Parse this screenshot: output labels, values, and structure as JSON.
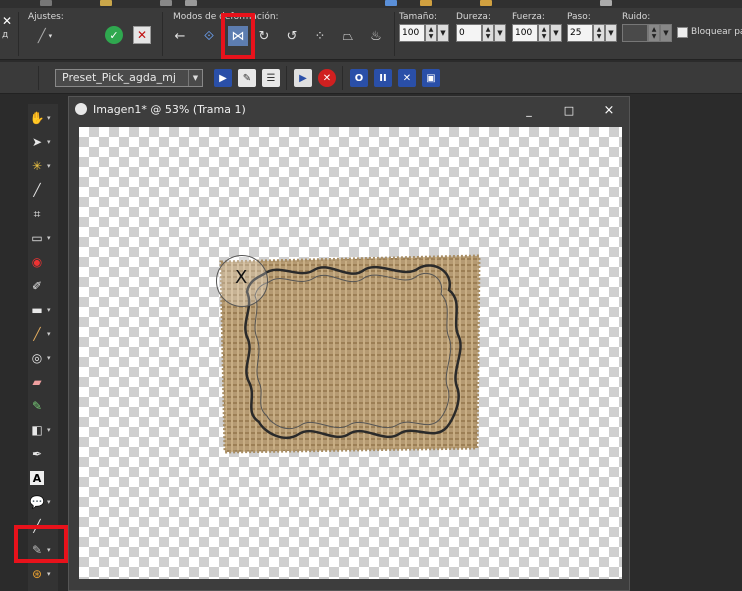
{
  "options": {
    "ajustes_label": "Ajustes:",
    "modos_label": "Modos de deformación:",
    "tamano": {
      "label": "Tamaño:",
      "value": "100"
    },
    "dureza": {
      "label": "Dureza:",
      "value": "0"
    },
    "fuerza": {
      "label": "Fuerza:",
      "value": "100"
    },
    "paso": {
      "label": "Paso:",
      "value": "25"
    },
    "ruido": {
      "label": "Ruido:",
      "value": ""
    },
    "lock_label": "Bloquear par",
    "left_fragment": "д"
  },
  "preset": {
    "selected": "Preset_Pick_agda_mj"
  },
  "image_window": {
    "title": "Imagen1* @  53% (Trama 1)",
    "minimize": "_",
    "maximize": "□",
    "close": "×"
  },
  "cursor_mark": "X",
  "colors": {
    "highlight": "#e8121b",
    "burlap": "#b59a72",
    "frame_line": "#2a2a2a"
  }
}
